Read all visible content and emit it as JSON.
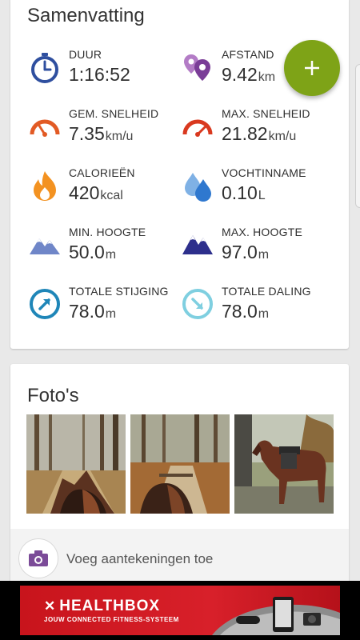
{
  "summary": {
    "title": "Samenvatting",
    "stats": [
      {
        "label": "DUUR",
        "value": "1:16:52",
        "unit": "",
        "icon": "stopwatch-icon"
      },
      {
        "label": "AFSTAND",
        "value": "9.42",
        "unit": "km",
        "icon": "map-pins-icon"
      },
      {
        "label": "GEM. SNELHEID",
        "value": "7.35",
        "unit": "km/u",
        "icon": "speedometer-icon"
      },
      {
        "label": "MAX. SNELHEID",
        "value": "21.82",
        "unit": "km/u",
        "icon": "speedometer-max-icon"
      },
      {
        "label": "CALORIEËN",
        "value": "420",
        "unit": "kcal",
        "icon": "flame-icon"
      },
      {
        "label": "VOCHTINNAME",
        "value": "0.10",
        "unit": "L",
        "icon": "water-drops-icon"
      },
      {
        "label": "MIN. HOOGTE",
        "value": "50.0",
        "unit": "m",
        "icon": "mountain-light-icon"
      },
      {
        "label": "MAX. HOOGTE",
        "value": "97.0",
        "unit": "m",
        "icon": "mountain-dark-icon"
      },
      {
        "label": "TOTALE STIJGING",
        "value": "78.0",
        "unit": "m",
        "icon": "arrow-up-circle-icon"
      },
      {
        "label": "TOTALE DALING",
        "value": "78.0",
        "unit": "m",
        "icon": "arrow-down-circle-icon"
      }
    ]
  },
  "fab": {
    "icon": "plus-icon",
    "color": "#7ea317"
  },
  "photos": {
    "title": "Foto's",
    "items": [
      "photo-forest-horse-ears",
      "photo-forest-trail-horse",
      "photo-horse-saddled"
    ]
  },
  "notes": {
    "label": "Voeg aantekeningen toe",
    "icon": "camera-icon"
  },
  "ad": {
    "brand": "HEALTHBOX",
    "tagline": "JOUW CONNECTED FITNESS-SYSTEEM",
    "color": "#d8202a"
  }
}
